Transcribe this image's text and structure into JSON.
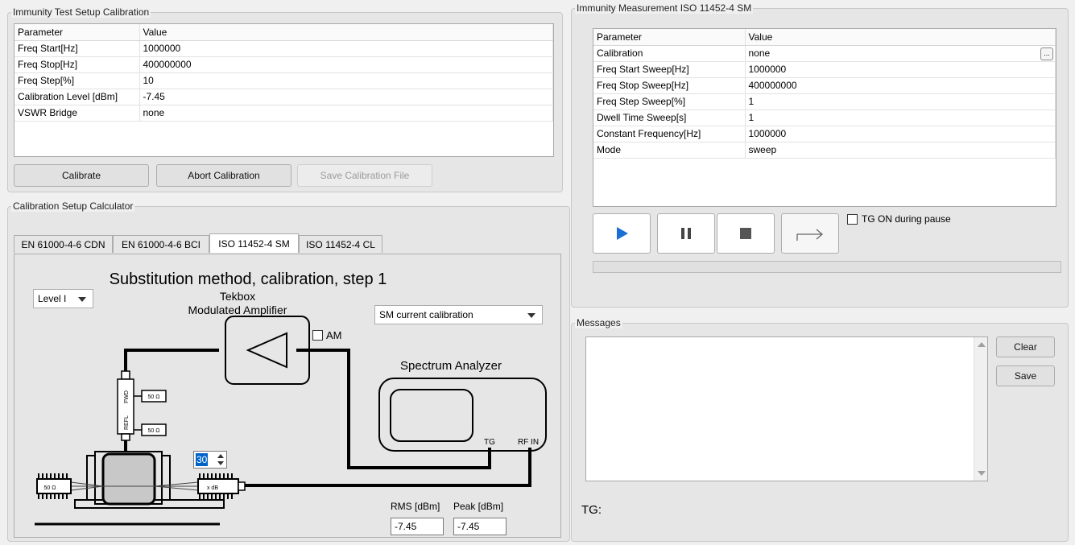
{
  "test_setup": {
    "title": "Immunity Test Setup Calibration",
    "headers": [
      "Parameter",
      "Value"
    ],
    "rows": [
      [
        "Freq Start[Hz]",
        "1000000"
      ],
      [
        "Freq Stop[Hz]",
        "400000000"
      ],
      [
        "Freq Step[%]",
        "10"
      ],
      [
        "Calibration Level [dBm]",
        "-7.45"
      ],
      [
        "VSWR Bridge",
        "none"
      ]
    ],
    "calibrate_label": "Calibrate",
    "abort_label": "Abort Calibration",
    "save_file_label": "Save Calibration File"
  },
  "calculator": {
    "title": "Calibration Setup Calculator",
    "tabs": [
      "EN 61000-4-6 CDN",
      "EN 61000-4-6 BCI",
      "ISO 11452-4 SM",
      "ISO 11452-4 CL"
    ],
    "active_tab": "ISO 11452-4 SM",
    "diagram_title": "Substitution method, calibration, step 1",
    "level_select": "Level I",
    "amp_title_1": "Tekbox",
    "amp_title_2": "Modulated Amplifier",
    "mode_select": "SM current calibration",
    "am_label": "AM",
    "analyzer_title": "Spectrum Analyzer",
    "tg_port": "TG",
    "rf_in_port": "RF IN",
    "fwd_label": "FWD",
    "refl_label": "REFL",
    "ohm_label": "50 Ω",
    "atten_label": "x dB",
    "atten_value": "30",
    "rms_label": "RMS [dBm]",
    "peak_label": "Peak [dBm]",
    "rms_value": "-7.45",
    "peak_value": "-7.45"
  },
  "measurement": {
    "title": "Immunity Measurement ISO 11452-4 SM",
    "headers": [
      "Parameter",
      "Value"
    ],
    "rows": [
      [
        "Calibration",
        "none"
      ],
      [
        "Freq Start Sweep[Hz]",
        "1000000"
      ],
      [
        "Freq Stop Sweep[Hz]",
        "400000000"
      ],
      [
        "Freq Step Sweep[%]",
        "1"
      ],
      [
        "Dwell Time Sweep[s]",
        "1"
      ],
      [
        "Constant Frequency[Hz]",
        "1000000"
      ],
      [
        "Mode",
        "sweep"
      ]
    ],
    "tg_pause_label": "TG ON during pause",
    "ellipsis": "..."
  },
  "messages": {
    "title": "Messages",
    "clear_label": "Clear",
    "save_label": "Save",
    "tg_label": "TG:"
  },
  "colors": {
    "play_accent": "#1a6fd6",
    "window_bg": "#f0f0f0"
  }
}
